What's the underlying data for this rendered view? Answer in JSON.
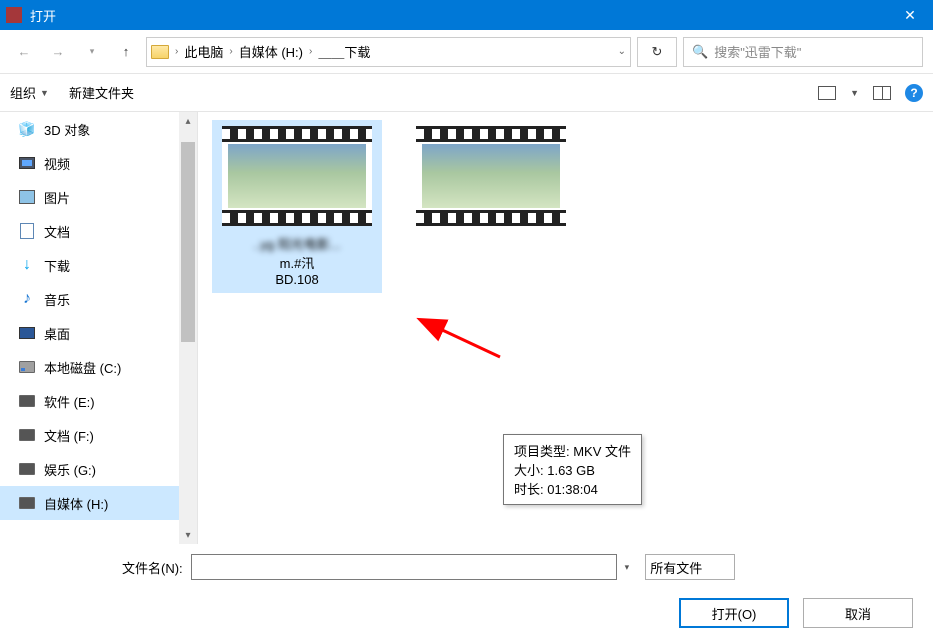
{
  "window": {
    "title": "打开"
  },
  "address": {
    "crumbs": [
      "此电脑",
      "自媒体 (H:)",
      "＿＿下载"
    ],
    "refresh_glyph": "↻"
  },
  "search": {
    "placeholder": "搜索\"迅雷下载\""
  },
  "toolbar": {
    "organize": "组织",
    "newfolder": "新建文件夹",
    "help_glyph": "?"
  },
  "sidebar": {
    "items": [
      {
        "label": "3D 对象",
        "icon": "3d"
      },
      {
        "label": "视频",
        "icon": "video"
      },
      {
        "label": "图片",
        "icon": "pic"
      },
      {
        "label": "文档",
        "icon": "doc"
      },
      {
        "label": "下载",
        "icon": "dl"
      },
      {
        "label": "音乐",
        "icon": "music"
      },
      {
        "label": "桌面",
        "icon": "desktop"
      },
      {
        "label": "本地磁盘 (C:)",
        "icon": "diskc"
      },
      {
        "label": "软件 (E:)",
        "icon": "disk"
      },
      {
        "label": "文档 (F:)",
        "icon": "disk"
      },
      {
        "label": "娱乐 (G:)",
        "icon": "disk"
      },
      {
        "label": "自媒体 (H:)",
        "icon": "disk",
        "selected": true
      }
    ]
  },
  "files": [
    {
      "name_lines": [
        "..yg 阳光电影...",
        "m.#汛",
        "BD.108"
      ],
      "selected": true
    },
    {
      "name_lines": [
        ""
      ],
      "selected": false
    }
  ],
  "tooltip": {
    "line1": "项目类型: MKV 文件",
    "line2": "大小: 1.63 GB",
    "line3": "时长: 01:38:04"
  },
  "bottom": {
    "filename_label": "文件名(N):",
    "filename_value": "",
    "filetype": "所有文件",
    "open_btn": "打开(O)",
    "cancel_btn": "取消"
  }
}
